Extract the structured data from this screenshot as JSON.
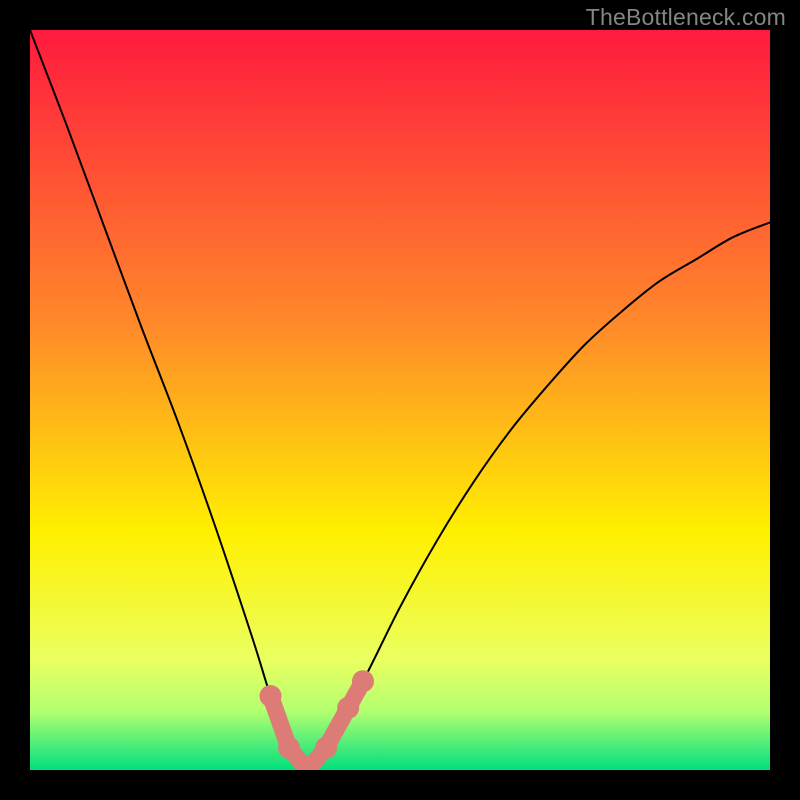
{
  "watermark": "TheBottleneck.com",
  "chart_data": {
    "type": "line",
    "title": "",
    "xlabel": "",
    "ylabel": "",
    "x": [
      0,
      5,
      10,
      15,
      20,
      25,
      30,
      32.5,
      35,
      37.5,
      40,
      45,
      50,
      55,
      60,
      65,
      70,
      75,
      80,
      85,
      90,
      95,
      100
    ],
    "y": [
      100,
      87,
      73.5,
      60,
      47,
      33,
      18,
      10,
      3,
      0,
      3,
      12,
      22,
      31,
      39,
      46,
      52,
      57.5,
      62,
      66,
      69,
      72,
      74
    ],
    "xlim": [
      0,
      100
    ],
    "ylim": [
      0,
      100
    ],
    "background_gradient": {
      "top": "#ff1a3e",
      "mid_upper": "#fff000",
      "mid_lower": "#c9ff5e",
      "bottom": "#00e07e"
    },
    "highlight_points_x": [
      32.5,
      35,
      37.5,
      40,
      43,
      45
    ],
    "highlight_color": "#dd7c76"
  }
}
